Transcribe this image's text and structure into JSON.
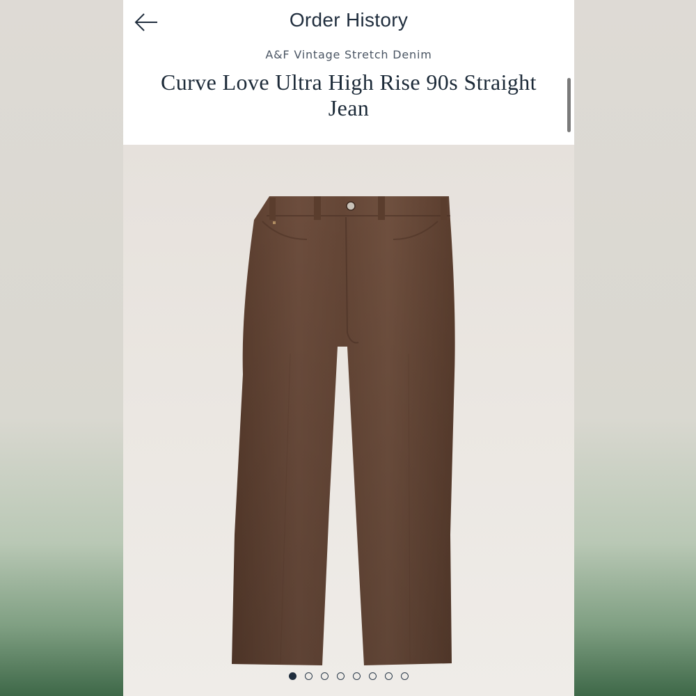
{
  "header": {
    "title": "Order History",
    "back_icon": "arrow-left-icon"
  },
  "product": {
    "brand": "A&F Vintage Stretch Denim",
    "name": "Curve Love Ultra High Rise 90s Straight Jean",
    "image_subject": "brown straight-leg jeans",
    "color": "#6b4a37"
  },
  "carousel": {
    "total": 8,
    "active_index": 0
  }
}
